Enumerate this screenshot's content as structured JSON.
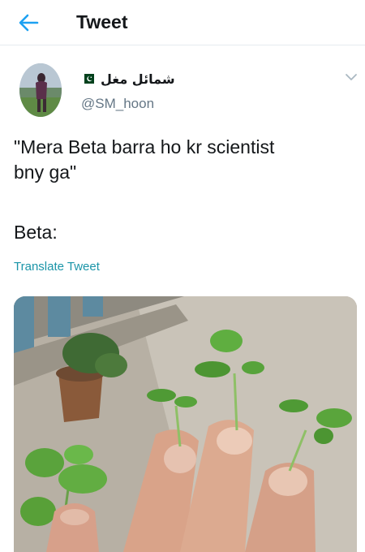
{
  "header": {
    "title": "Tweet",
    "back_icon": "arrow-left-icon",
    "accent_color": "#1da1f2"
  },
  "author": {
    "display_name": "شمائل مغل",
    "handle": "@SM_hoon",
    "flag_icon": "pakistan-flag-icon",
    "menu_icon": "chevron-down-icon"
  },
  "tweet": {
    "text": "\"Mera Beta barra ho kr scientist\nbny ga\"",
    "text_line2": "Beta:",
    "translate_label": "Translate Tweet",
    "translate_color": "#1b95a8"
  },
  "media": {
    "type": "photo"
  }
}
